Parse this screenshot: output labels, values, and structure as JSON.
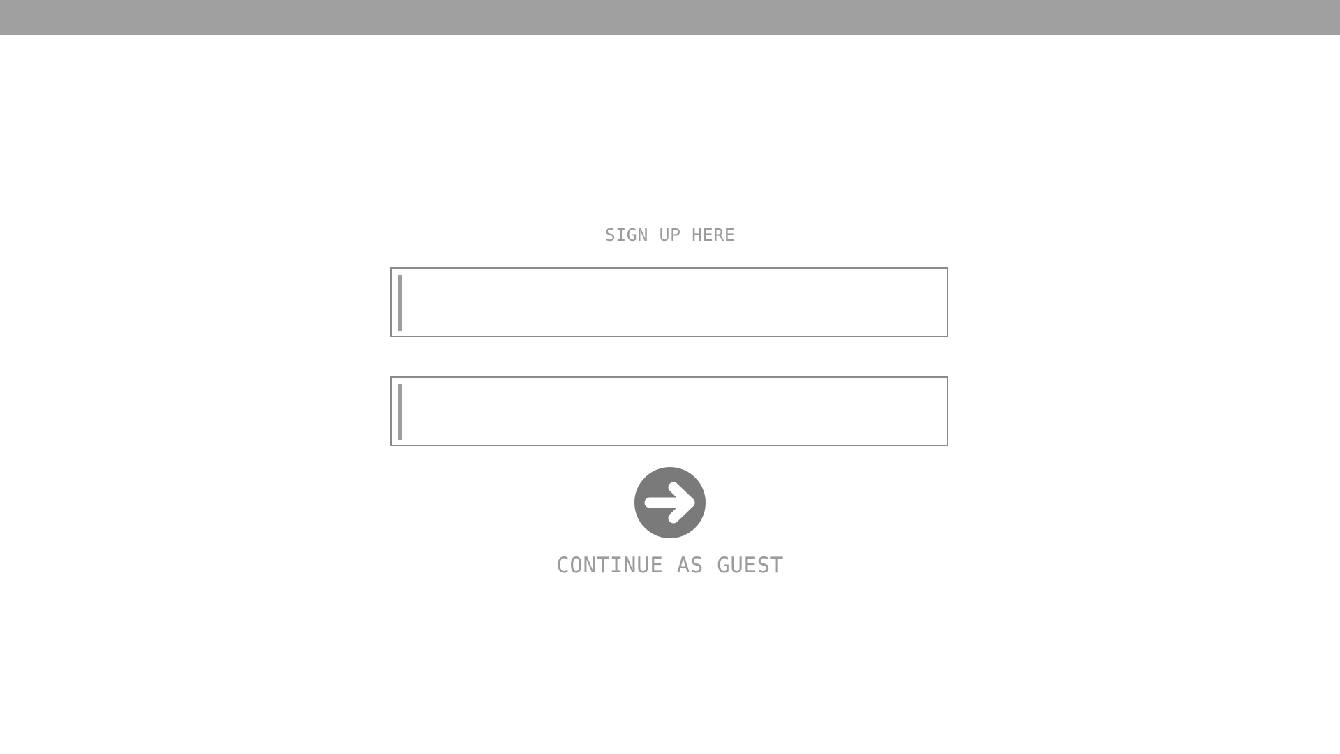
{
  "signup": {
    "heading": "SIGN UP HERE",
    "fields": [
      {
        "value": "",
        "placeholder": ""
      },
      {
        "value": "",
        "placeholder": ""
      }
    ],
    "submit_icon": "arrow-right-circle-icon",
    "guest_label": "CONTINUE AS GUEST"
  },
  "colors": {
    "top_bar": "#a0a0a0",
    "text": "#9b9b9b",
    "button": "#7a7a7a",
    "field_border": "#8a8a8a"
  }
}
